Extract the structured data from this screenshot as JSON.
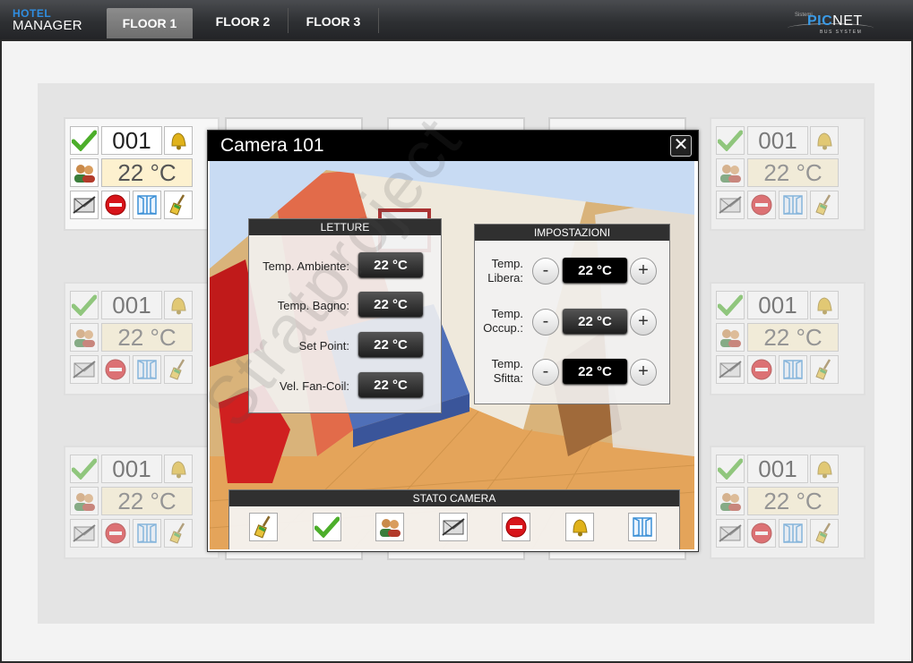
{
  "header": {
    "brand_top": "HOTEL",
    "brand_bottom": "MANAGER",
    "tabs": [
      {
        "label": "FLOOR 1",
        "active": true
      },
      {
        "label": "FLOOR 2",
        "active": false
      },
      {
        "label": "FLOOR 3",
        "active": false
      }
    ],
    "logo": {
      "small": "Sistemi",
      "pic": "PIC",
      "net": "NET",
      "sub": "BUS SYSTEM"
    }
  },
  "rooms": [
    {
      "number": "001",
      "temperature": "22 °C"
    },
    {
      "number": "001",
      "temperature": "22 °C"
    },
    {
      "number": "001",
      "temperature": "22 °C"
    },
    {
      "number": "001",
      "temperature": "22 °C"
    },
    {
      "number": "001",
      "temperature": "22 °C"
    },
    {
      "number": "001",
      "temperature": "22 °C"
    }
  ],
  "modal": {
    "title": "Camera 101",
    "close_symbol": "✕",
    "letture": {
      "title": "LETTURE",
      "rows": [
        {
          "label": "Temp. Ambiente:",
          "value": "22 °C"
        },
        {
          "label": "Temp. Bagno:",
          "value": "22 °C"
        },
        {
          "label": "Set Point:",
          "value": "22 °C"
        },
        {
          "label": "Vel. Fan-Coil:",
          "value": "22 °C"
        }
      ]
    },
    "impostazioni": {
      "title": "IMPOSTAZIONI",
      "minus": "-",
      "plus": "+",
      "rows": [
        {
          "label_1": "Temp.",
          "label_2": "Libera:",
          "value": "22 °C"
        },
        {
          "label_1": "Temp.",
          "label_2": "Occup.:",
          "value": "22 °C"
        },
        {
          "label_1": "Temp.",
          "label_2": "Sfitta:",
          "value": "22 °C"
        }
      ]
    },
    "stato_camera": {
      "title": "STATO CAMERA",
      "icons": [
        "broom-icon",
        "check-icon",
        "guests-icon",
        "crossed-envelope-icon",
        "no-entry-icon",
        "bell-icon",
        "door-icon"
      ]
    }
  },
  "watermark": "Stratproject",
  "colors": {
    "accent_blue": "#2f8de0",
    "temp_bg": "#fdf1cf",
    "check_green": "#4cae2a",
    "no_entry_red": "#d7141a",
    "bell_gold": "#e0b21a",
    "door_blue": "#3b8fd5"
  }
}
